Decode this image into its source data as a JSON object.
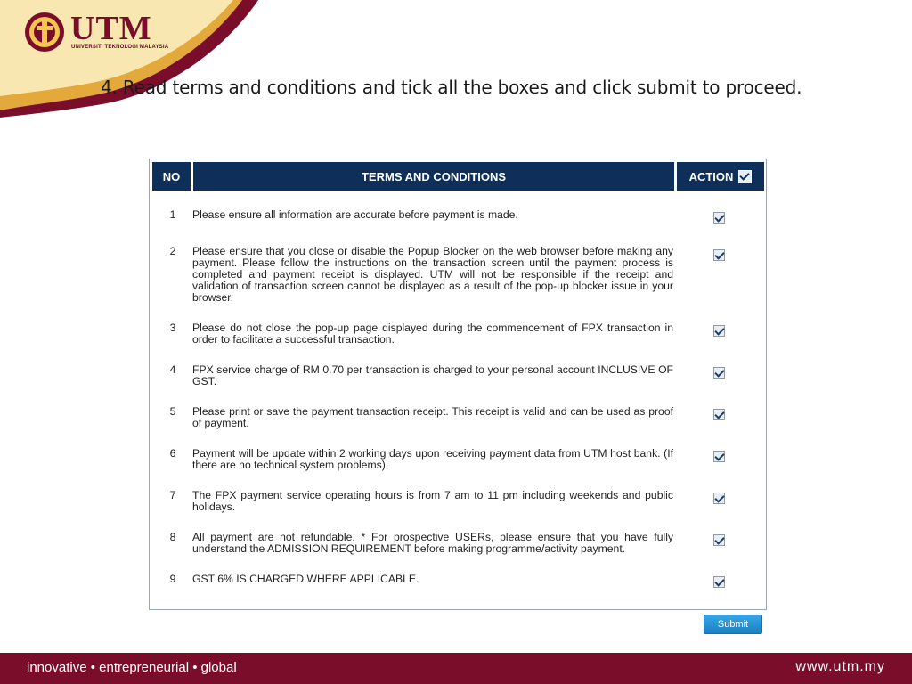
{
  "logo": {
    "name": "UTM",
    "subtitle": "UNIVERSITI TEKNOLOGI MALAYSIA",
    "icon": "utm-crest-icon"
  },
  "slide_title": "4. Read terms and conditions and tick all the boxes and click submit to proceed.",
  "table": {
    "headers": {
      "no": "NO",
      "terms": "TERMS AND CONDITIONS",
      "action": "ACTION"
    },
    "rows": [
      {
        "no": "1",
        "text": "Please ensure all information are accurate before payment is made.",
        "checked": true
      },
      {
        "no": "2",
        "text": "Please ensure that you close or disable the Popup Blocker on the web browser before making any payment. Please follow the instructions on the transaction screen until the payment process is completed and payment receipt is displayed. UTM will not be responsible if the receipt and validation of transaction screen cannot be displayed as a result of the pop-up blocker issue in your browser.",
        "checked": true
      },
      {
        "no": "3",
        "text": "Please do not close the pop-up page displayed during the commencement of FPX transaction in order to facilitate a successful transaction.",
        "checked": true
      },
      {
        "no": "4",
        "text": "FPX service charge of RM 0.70 per transaction is charged to your personal account INCLUSIVE OF GST.",
        "checked": true
      },
      {
        "no": "5",
        "text": "Please print or save the payment transaction receipt. This receipt is valid and can be used as proof of payment.",
        "checked": true
      },
      {
        "no": "6",
        "text": "Payment will be update within 2 working days upon receiving payment data from UTM host bank. (If there are no technical system problems).",
        "checked": true
      },
      {
        "no": "7",
        "text": "The FPX payment service operating hours is from 7 am to 11 pm including weekends and public holidays.",
        "checked": true
      },
      {
        "no": "8",
        "text": "All payment are not refundable. * For prospective USERs, please ensure that you have fully understand the ADMISSION REQUIREMENT before making programme/activity payment.",
        "checked": true
      },
      {
        "no": "9",
        "text": "GST 6% IS CHARGED WHERE APPLICABLE.",
        "checked": true
      }
    ]
  },
  "submit_label": "Submit",
  "footer": {
    "tagline": "innovative • entrepreneurial • global",
    "website": "www.utm.my"
  },
  "colors": {
    "brand_maroon": "#7a0e2a",
    "brand_gold": "#e8b94a",
    "header_navy": "#0d2f5a",
    "button_blue": "#2a93d6"
  }
}
